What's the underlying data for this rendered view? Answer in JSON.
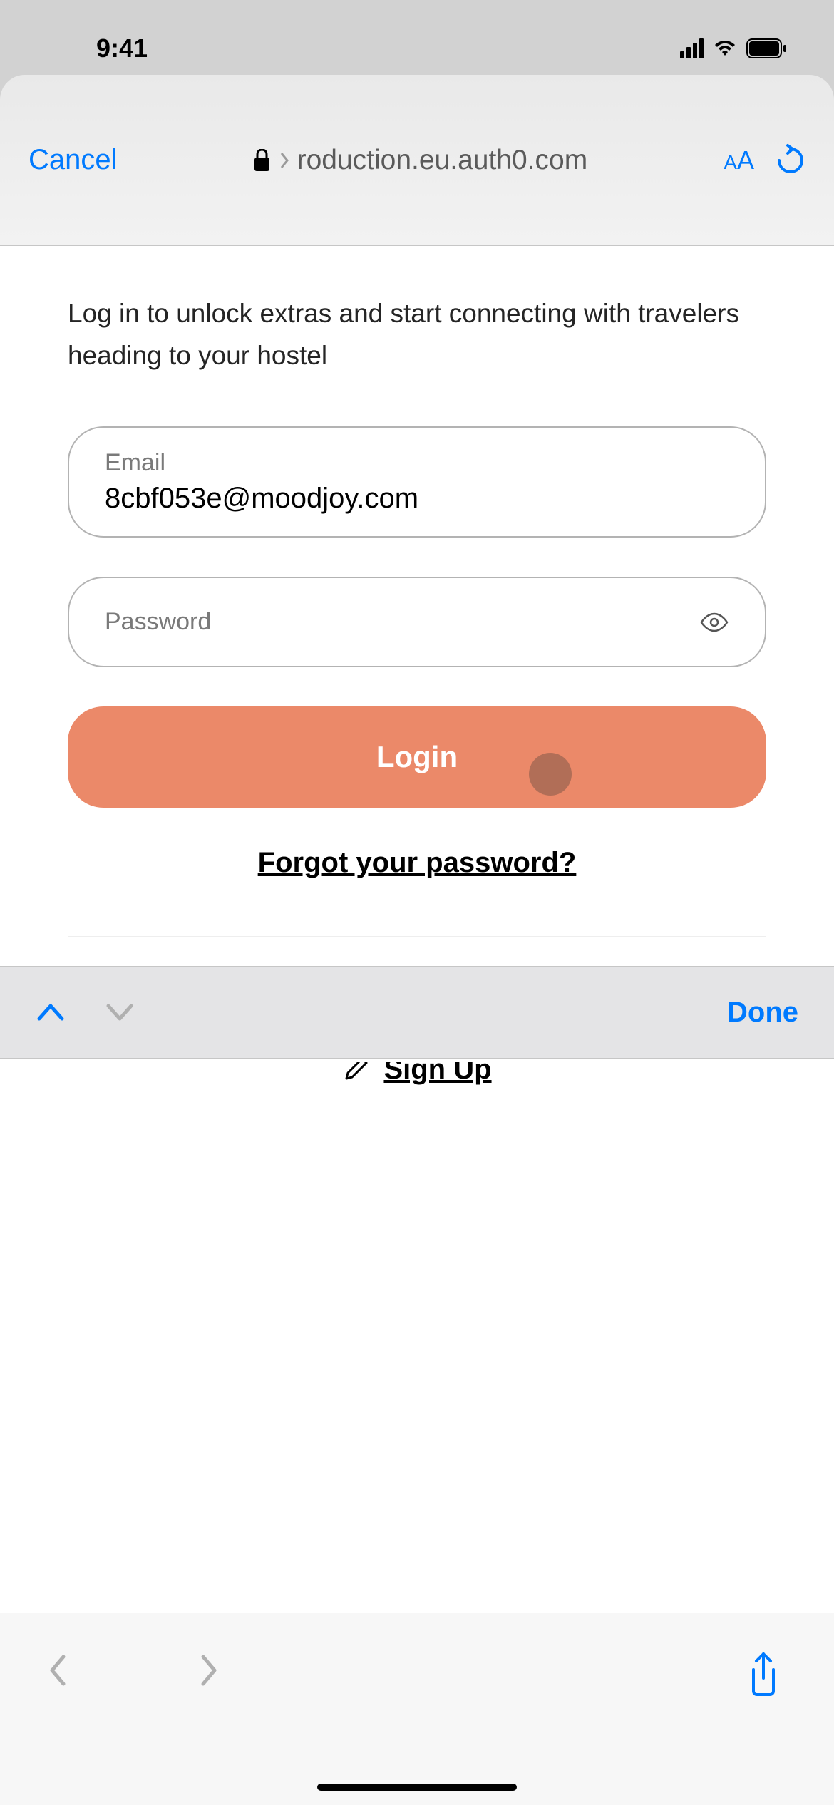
{
  "status_bar": {
    "time": "9:41"
  },
  "toolbar": {
    "cancel_label": "Cancel",
    "address_text": "roduction.eu.auth0.com",
    "aa_label": "A"
  },
  "page": {
    "intro": "Log in to unlock extras and start connecting with travelers heading to your hostel",
    "email_label": "Email",
    "email_value": "8cbf053e@moodjoy.com",
    "password_label": "Password",
    "login_button": "Login",
    "forgot_link": "Forgot your password?",
    "signup_link": "Sign Up"
  },
  "keyboard_accessory": {
    "done_label": "Done"
  }
}
